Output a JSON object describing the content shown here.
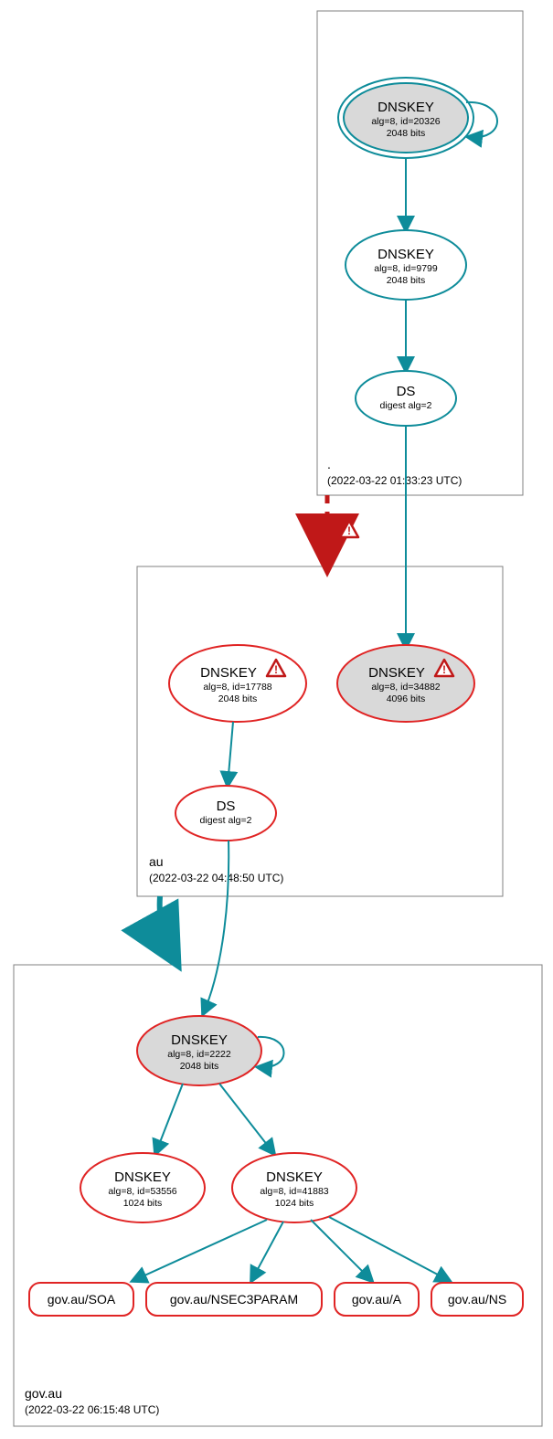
{
  "zones": {
    "root": {
      "name": ".",
      "timestamp": "(2022-03-22 01:33:23 UTC)"
    },
    "au": {
      "name": "au",
      "timestamp": "(2022-03-22 04:48:50 UTC)"
    },
    "govau": {
      "name": "gov.au",
      "timestamp": "(2022-03-22 06:15:48 UTC)"
    }
  },
  "nodes": {
    "root_ksk": {
      "title": "DNSKEY",
      "line2": "alg=8, id=20326",
      "line3": "2048 bits"
    },
    "root_zsk": {
      "title": "DNSKEY",
      "line2": "alg=8, id=9799",
      "line3": "2048 bits"
    },
    "root_ds": {
      "title": "DS",
      "line2": "digest alg=2"
    },
    "au_zsk": {
      "title": "DNSKEY",
      "line2": "alg=8, id=17788",
      "line3": "2048 bits"
    },
    "au_ksk": {
      "title": "DNSKEY",
      "line2": "alg=8, id=34882",
      "line3": "4096 bits"
    },
    "au_ds": {
      "title": "DS",
      "line2": "digest alg=2"
    },
    "gov_ksk": {
      "title": "DNSKEY",
      "line2": "alg=8, id=2222",
      "line3": "2048 bits"
    },
    "gov_zsk1": {
      "title": "DNSKEY",
      "line2": "alg=8, id=53556",
      "line3": "1024 bits"
    },
    "gov_zsk2": {
      "title": "DNSKEY",
      "line2": "alg=8, id=41883",
      "line3": "1024 bits"
    }
  },
  "rrsets": {
    "soa": "gov.au/SOA",
    "nsec3": "gov.au/NSEC3PARAM",
    "a": "gov.au/A",
    "ns": "gov.au/NS"
  }
}
